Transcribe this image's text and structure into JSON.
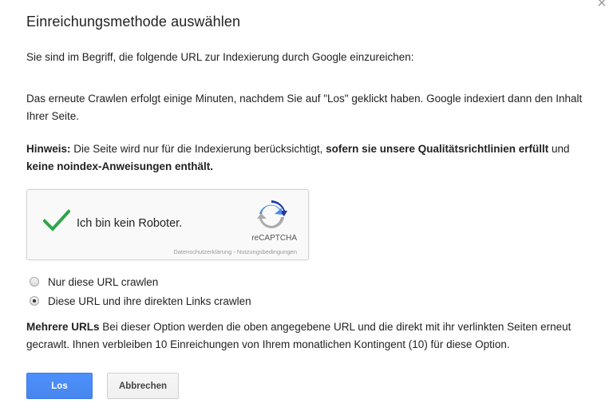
{
  "dialog": {
    "title": "Einreichungsmethode auswählen",
    "close_glyph": "×",
    "intro": "Sie sind im Begriff, die folgende URL zur Indexierung durch Google einzureichen:",
    "recrawl_info": "Das erneute Crawlen erfolgt einige Minuten, nachdem Sie auf \"Los\" geklickt haben. Google indexiert dann den Inhalt Ihrer Seite.",
    "note": {
      "label": "Hinweis:",
      "text_1": " Die Seite wird nur für die Indexierung berücksichtigt, ",
      "bold_1": "sofern sie unsere Qualitätsrichtlinien erfüllt",
      "text_2": " und ",
      "bold_2": "keine noindex-Anweisungen enthält."
    }
  },
  "captcha": {
    "label": "Ich bin kein Roboter.",
    "brand": "reCAPTCHA",
    "legal": "Datenschutzerklärung - Nutzungsbedingungen",
    "checked": true,
    "check_color": "#2ea54a",
    "icon": "recaptcha-logo"
  },
  "options": [
    {
      "label": "Nur diese URL crawlen",
      "selected": false
    },
    {
      "label": "Diese URL und ihre direkten Links crawlen",
      "selected": true
    }
  ],
  "multi_info": {
    "label": "Mehrere URLs",
    "text": " Bei dieser Option werden die oben angegebene URL und die direkt mit ihr verlinkten Seiten erneut gecrawlt. Ihnen verbleiben 10 Einreichungen von Ihrem monatlichen Kontingent (10) für diese Option."
  },
  "buttons": {
    "submit": "Los",
    "cancel": "Abbrechen"
  },
  "colors": {
    "primary": "#4d90fe",
    "text": "#222222"
  }
}
